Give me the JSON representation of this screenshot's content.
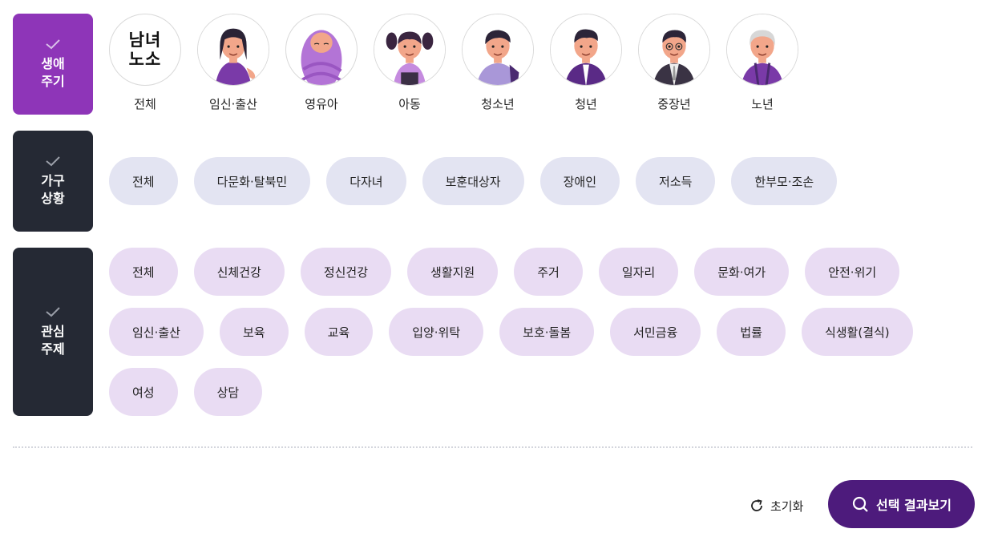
{
  "life_cycle": {
    "label": "생애\n주기",
    "items": [
      {
        "label": "전체",
        "icon": "gender-all-icon",
        "text_lines": [
          "남녀",
          "노소"
        ]
      },
      {
        "label": "임신·출산",
        "icon": "pregnant-woman-avatar"
      },
      {
        "label": "영유아",
        "icon": "baby-avatar"
      },
      {
        "label": "아동",
        "icon": "child-avatar"
      },
      {
        "label": "청소년",
        "icon": "teen-avatar"
      },
      {
        "label": "청년",
        "icon": "young-adult-avatar"
      },
      {
        "label": "중장년",
        "icon": "middle-aged-avatar"
      },
      {
        "label": "노년",
        "icon": "elderly-avatar"
      }
    ]
  },
  "household": {
    "label": "가구\n상황",
    "items": [
      "전체",
      "다문화·탈북민",
      "다자녀",
      "보훈대상자",
      "장애인",
      "저소득",
      "한부모·조손"
    ]
  },
  "interest": {
    "label": "관심\n주제",
    "items": [
      "전체",
      "신체건강",
      "정신건강",
      "생활지원",
      "주거",
      "일자리",
      "문화·여가",
      "안전·위기",
      "임신·출산",
      "보육",
      "교육",
      "입양·위탁",
      "보호·돌봄",
      "서민금융",
      "법률",
      "식생활(결식)",
      "여성",
      "상담"
    ]
  },
  "actions": {
    "reset_label": "초기화",
    "search_label": "선택 결과보기"
  },
  "colors": {
    "life_label_bg": "#8e35b8",
    "dark_label_bg": "#252934",
    "household_chip_bg": "#e3e4f2",
    "interest_chip_bg": "#e9dcf3",
    "search_button_bg": "#4d1b7c"
  }
}
